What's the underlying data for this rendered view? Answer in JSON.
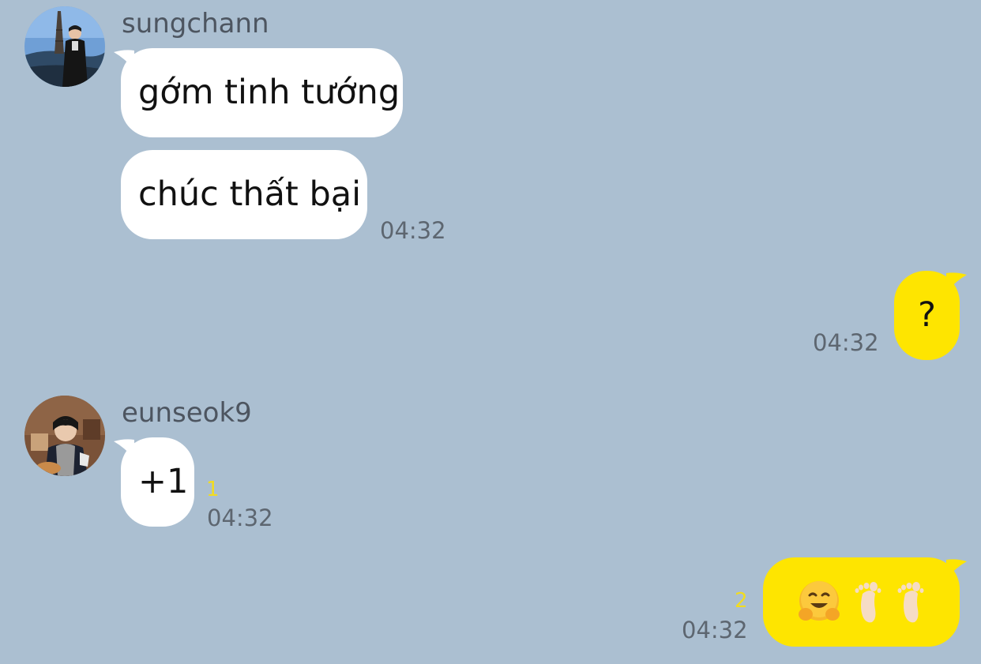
{
  "colors": {
    "chat_background": "#abbfd1",
    "incoming_bubble": "#ffffff",
    "outgoing_bubble": "#fee500",
    "unread_count": "#f2dc1f",
    "timestamp": "#5d6670",
    "sender_name": "#4d5560"
  },
  "messages": [
    {
      "sender": "sungchann",
      "avatar_icon": "profile-photo-eiffel-tower",
      "bubbles": [
        "gớm tinh tướng",
        "chúc thất bại"
      ],
      "time": "04:32"
    },
    {
      "sender": "me",
      "bubbles": [
        "?"
      ],
      "time": "04:32"
    },
    {
      "sender": "eunseok9",
      "avatar_icon": "profile-photo-varsity-jacket",
      "bubbles": [
        "+1"
      ],
      "unread": "1",
      "time": "04:32"
    },
    {
      "sender": "me",
      "emoji_icons": [
        "hugging-face-emoji",
        "footprint-emoji",
        "footprint-emoji"
      ],
      "unread": "2",
      "time": "04:32"
    }
  ]
}
